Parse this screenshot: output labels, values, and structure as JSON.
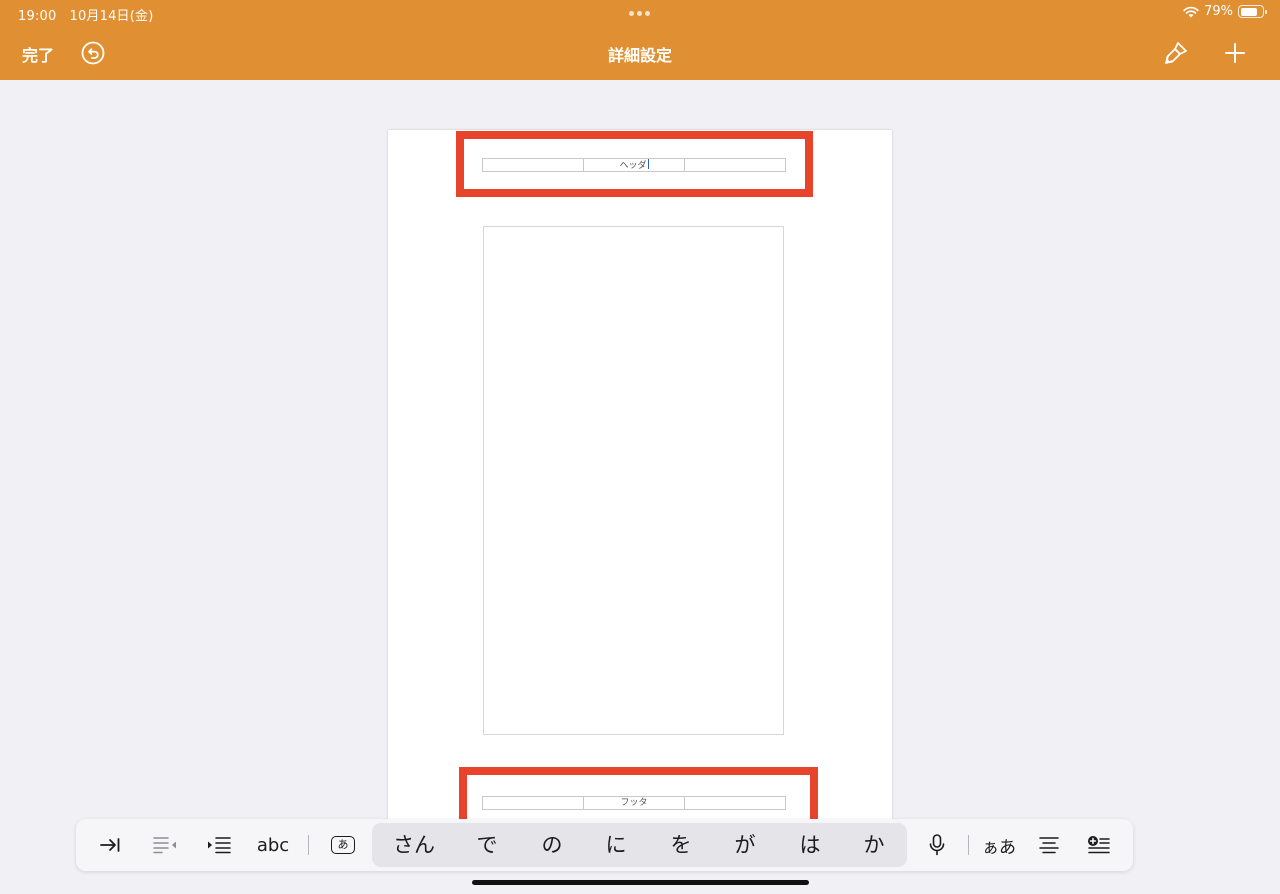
{
  "status_bar": {
    "time": "19:00",
    "date": "10月14日(金)",
    "battery": "79%",
    "battery_level": 0.79
  },
  "nav": {
    "done_label": "完了",
    "title": "詳細設定"
  },
  "document": {
    "header": {
      "center_text": "ヘッダ"
    },
    "footer": {
      "center_text": "フッタ"
    }
  },
  "keyboard_bar": {
    "abc_label": "abc",
    "kana_label": "あ",
    "candidates": [
      "さん",
      "で",
      "の",
      "に",
      "を",
      "が",
      "は",
      "か"
    ],
    "kana_size_label": "ぁあ"
  },
  "colors": {
    "toolbar": "#e09033",
    "highlight": "#e8442c",
    "background": "#f0f0f5"
  }
}
